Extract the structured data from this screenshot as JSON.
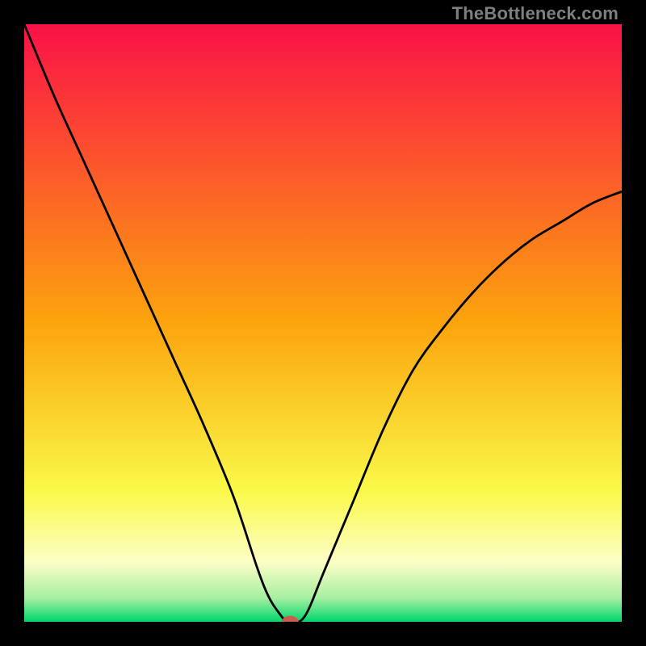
{
  "watermark": "TheBottleneck.com",
  "chart_data": {
    "type": "line",
    "title": "",
    "xlabel": "",
    "ylabel": "",
    "xlim": [
      0,
      100
    ],
    "ylim": [
      0,
      100
    ],
    "background_gradient": {
      "stops": [
        {
          "pos": 0.0,
          "color": "#fb1147"
        },
        {
          "pos": 0.5,
          "color": "#fca40d"
        },
        {
          "pos": 0.78,
          "color": "#faf948"
        },
        {
          "pos": 0.9,
          "color": "#fcfec6"
        },
        {
          "pos": 0.96,
          "color": "#a7efa1"
        },
        {
          "pos": 1.0,
          "color": "#00d66d"
        }
      ]
    },
    "series": [
      {
        "name": "bottleneck-curve",
        "stroke": "#000000",
        "x": [
          0,
          5,
          10,
          15,
          20,
          25,
          30,
          35,
          39,
          41,
          43,
          44,
          45,
          46,
          47,
          48,
          50,
          55,
          60,
          65,
          70,
          75,
          80,
          85,
          90,
          95,
          100
        ],
        "y": [
          100,
          88,
          77,
          66,
          55,
          44,
          33,
          21,
          9,
          4,
          1,
          0,
          0,
          0,
          1,
          3,
          8,
          20,
          32,
          42,
          49,
          55,
          60,
          64,
          67,
          70,
          72
        ]
      }
    ],
    "marker": {
      "name": "optimal-point",
      "x": 44.5,
      "y": 0,
      "rx": 1.4,
      "ry": 1.0,
      "fill": "#cb5b4c"
    }
  }
}
